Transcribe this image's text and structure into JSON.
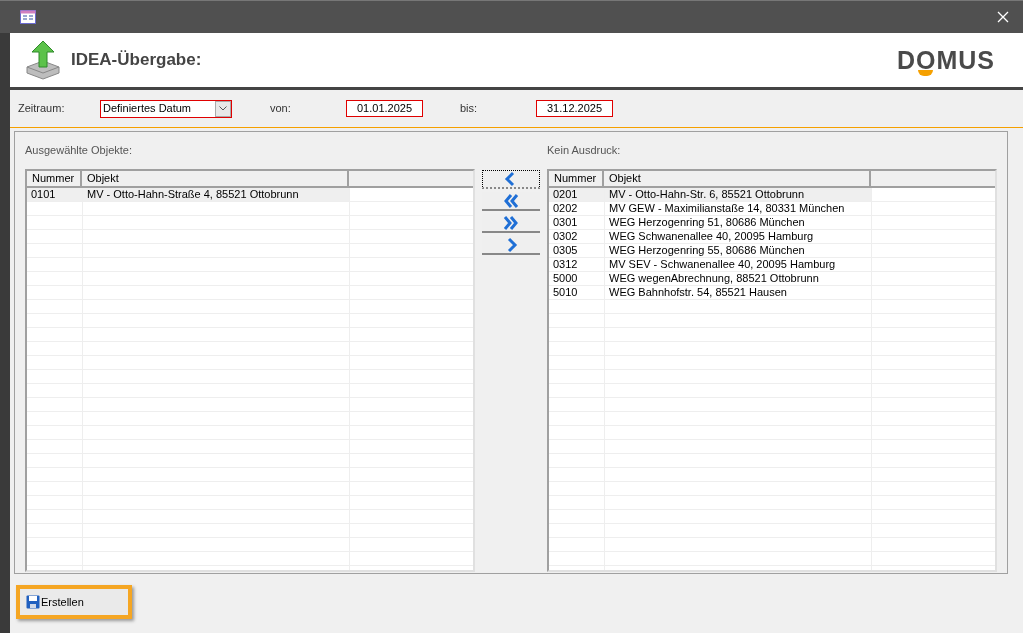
{
  "header": {
    "title": "IDEA-Übergabe:",
    "logo": "DOMUS"
  },
  "filter": {
    "label": "Zeitraum:",
    "period": "Definiertes Datum",
    "from_label": "von:",
    "from": "01.01.2025",
    "to_label": "bis:",
    "to": "31.12.2025"
  },
  "selected_list": {
    "title": "Ausgewählte Objekte:",
    "columns": [
      "Nummer",
      "Objekt"
    ],
    "rows": [
      {
        "number": "0101",
        "object": "MV - Otto-Hahn-Straße 4, 85521 Ottobrunn",
        "selected": true
      }
    ]
  },
  "move_buttons": [
    {
      "kind": "left",
      "focused": true
    },
    {
      "kind": "double-left",
      "focused": false
    },
    {
      "kind": "double-right",
      "focused": false
    },
    {
      "kind": "right",
      "focused": false
    }
  ],
  "excluded_list": {
    "title": "Kein Ausdruck:",
    "columns": [
      "Nummer",
      "Objekt"
    ],
    "rows": [
      {
        "number": "0201",
        "object": "MV - Otto-Hahn-Str. 6, 85521 Ottobrunn",
        "selected": true
      },
      {
        "number": "0202",
        "object": "MV GEW - Maximilianstaße 14, 80331 München",
        "selected": false
      },
      {
        "number": "0301",
        "object": "WEG Herzogenring 51, 80686 München",
        "selected": false
      },
      {
        "number": "0302",
        "object": "WEG Schwanenallee 40, 20095 Hamburg",
        "selected": false
      },
      {
        "number": "0305",
        "object": "WEG Herzogenring 55, 80686 München",
        "selected": false
      },
      {
        "number": "0312",
        "object": "MV SEV - Schwanenallee 40, 20095 Hamburg",
        "selected": false
      },
      {
        "number": "5000",
        "object": "WEG wegenAbrechnung, 88521 Ottobrunn",
        "selected": false
      },
      {
        "number": "5010",
        "object": "WEG Bahnhofstr. 54, 85521 Hausen",
        "selected": false
      }
    ]
  },
  "create_button": {
    "label": "Erstellen",
    "highlighted": true
  }
}
